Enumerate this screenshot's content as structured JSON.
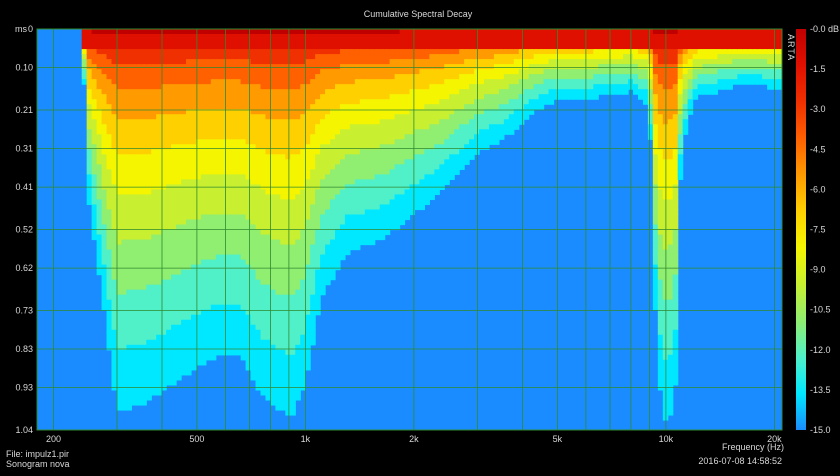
{
  "colors": {
    "background": "#000000",
    "grid": "#2f8a2f",
    "text": "#d8d8d8"
  },
  "chart_data": {
    "type": "heatmap",
    "title": "Cumulative Spectral Decay",
    "watermark": "ARTA",
    "xlabel": "Frequency (Hz)",
    "ylabel": "ms",
    "x_scale": "log",
    "xlim": [
      180,
      21000
    ],
    "ylim": [
      0,
      1.04
    ],
    "grid": true,
    "x_ticks": [
      {
        "value": 200,
        "label": "200"
      },
      {
        "value": 500,
        "label": "500"
      },
      {
        "value": 1000,
        "label": "1k"
      },
      {
        "value": 2000,
        "label": "2k"
      },
      {
        "value": 5000,
        "label": "5k"
      },
      {
        "value": 10000,
        "label": "10k"
      },
      {
        "value": 20000,
        "label": "20k"
      }
    ],
    "x_grid": [
      200,
      300,
      400,
      500,
      600,
      700,
      800,
      900,
      1000,
      2000,
      3000,
      4000,
      5000,
      6000,
      7000,
      8000,
      9000,
      10000,
      20000
    ],
    "y_ticks": [
      {
        "value": 0,
        "label": "0"
      },
      {
        "value": 0.1,
        "label": "0.10"
      },
      {
        "value": 0.21,
        "label": "0.21"
      },
      {
        "value": 0.31,
        "label": "0.31"
      },
      {
        "value": 0.41,
        "label": "0.41"
      },
      {
        "value": 0.52,
        "label": "0.52"
      },
      {
        "value": 0.62,
        "label": "0.62"
      },
      {
        "value": 0.73,
        "label": "0.73"
      },
      {
        "value": 0.83,
        "label": "0.83"
      },
      {
        "value": 0.93,
        "label": "0.93"
      },
      {
        "value": 1.04,
        "label": "1.04"
      }
    ],
    "colorbar": {
      "unit": "dB",
      "labels": [
        "-0.0 dB",
        "-1.5",
        "-3.0",
        "-4.5",
        "-6.0",
        "-7.5",
        "-9.0",
        "-10.5",
        "-12.0",
        "-13.5",
        "-15.0"
      ],
      "colors": [
        "#c00000",
        "#e01000",
        "#f03000",
        "#ff6000",
        "#ff9a00",
        "#ffd000",
        "#f5f500",
        "#c8f030",
        "#90ee70",
        "#50f0c8",
        "#00e8ff",
        "#1a8cff"
      ]
    },
    "decay_ms_to_minus15dB": {
      "freq_hz": [
        180,
        240,
        250,
        270,
        300,
        360,
        460,
        560,
        660,
        760,
        880,
        920,
        1000,
        1100,
        1300,
        1600,
        2000,
        2400,
        3000,
        3600,
        4200,
        5000,
        6000,
        7000,
        8000,
        9000,
        9400,
        9800,
        10200,
        10600,
        11000,
        12000,
        14000,
        17000,
        21000
      ],
      "ms": [
        0.0,
        0.0,
        0.44,
        0.66,
        0.99,
        0.97,
        0.9,
        0.85,
        0.85,
        0.95,
        1.0,
        1.0,
        0.92,
        0.7,
        0.58,
        0.55,
        0.48,
        0.42,
        0.32,
        0.28,
        0.22,
        0.18,
        0.18,
        0.17,
        0.16,
        0.2,
        0.8,
        1.02,
        1.02,
        0.95,
        0.32,
        0.18,
        0.16,
        0.14,
        0.16
      ]
    }
  },
  "footer": {
    "file": "File: impulz1.pir",
    "label": "Sonogram nova",
    "datetime": "2016-07-08  14:58:52"
  }
}
